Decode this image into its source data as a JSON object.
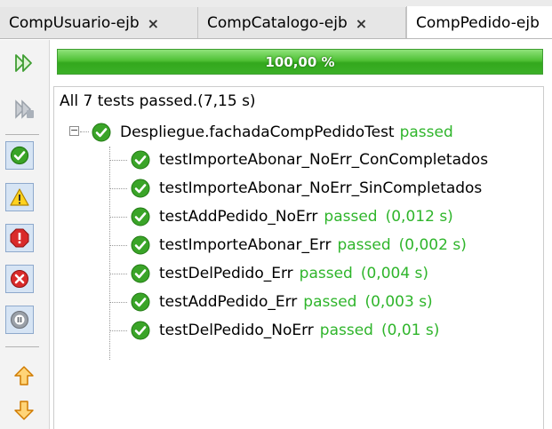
{
  "tabs": [
    {
      "label": "CompUsuario-ejb",
      "close": "×"
    },
    {
      "label": "CompCatalogo-ejb",
      "close": "×"
    },
    {
      "label": "CompPedido-ejb",
      "close": ""
    }
  ],
  "toolbar": {
    "buttons": [
      "rerun-icon",
      "rerun-failed-icon",
      "show-passed-icon",
      "show-warnings-icon",
      "show-errors-icon",
      "show-failures-icon",
      "show-aborted-icon",
      "previous-icon",
      "next-icon"
    ]
  },
  "progress": {
    "text": "100,00 %",
    "value": 1.0,
    "color": "#3bb027"
  },
  "summary": "All 7 tests passed.(7,15 s)",
  "suite": {
    "name": "Despliegue.fachadaCompPedidoTest",
    "status": "passed"
  },
  "tests": [
    {
      "name": "testImporteAbonar_NoErr_ConCompletados",
      "status": "",
      "time": ""
    },
    {
      "name": "testImporteAbonar_NoErr_SinCompletados",
      "status": "",
      "time": ""
    },
    {
      "name": "testAddPedido_NoErr",
      "status": "passed",
      "time": "(0,012 s)"
    },
    {
      "name": "testImporteAbonar_Err",
      "status": "passed",
      "time": "(0,002 s)"
    },
    {
      "name": "testDelPedido_Err",
      "status": "passed",
      "time": "(0,004 s)"
    },
    {
      "name": "testAddPedido_Err",
      "status": "passed",
      "time": "(0,003 s)"
    },
    {
      "name": "testDelPedido_NoErr",
      "status": "passed",
      "time": "(0,01 s)"
    }
  ]
}
